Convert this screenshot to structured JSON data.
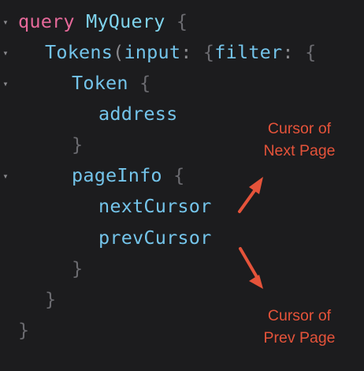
{
  "editor": {
    "lines": [
      {
        "query_kw": "query",
        "name": "MyQuery",
        "open": "{"
      },
      {
        "tokens": "Tokens",
        "paren": "(",
        "input": "input",
        "colon": ":",
        "space": " ",
        "open1": "{",
        "filter": "filter",
        "colon2": ":",
        "space2": " ",
        "open2": "{"
      },
      {
        "token": "Token",
        "open": "{"
      },
      {
        "address": "address"
      },
      {
        "close": "}"
      },
      {
        "pageinfo": "pageInfo",
        "open": "{"
      },
      {
        "next": "nextCursor"
      },
      {
        "prev": "prevCursor"
      },
      {
        "close": "}"
      },
      {
        "close": "}"
      },
      {
        "close": "}"
      }
    ],
    "fold_icon": "▾"
  },
  "annotations": {
    "next_cursor_line1": "Cursor of",
    "next_cursor_line2": "Next Page",
    "prev_cursor_line1": "Cursor of",
    "prev_cursor_line2": "Prev Page"
  },
  "colors": {
    "background": "#1c1c1e",
    "keyword": "#e6699a",
    "field": "#74c4ea",
    "brace": "#6b6b70",
    "annotation": "#e5533a"
  }
}
